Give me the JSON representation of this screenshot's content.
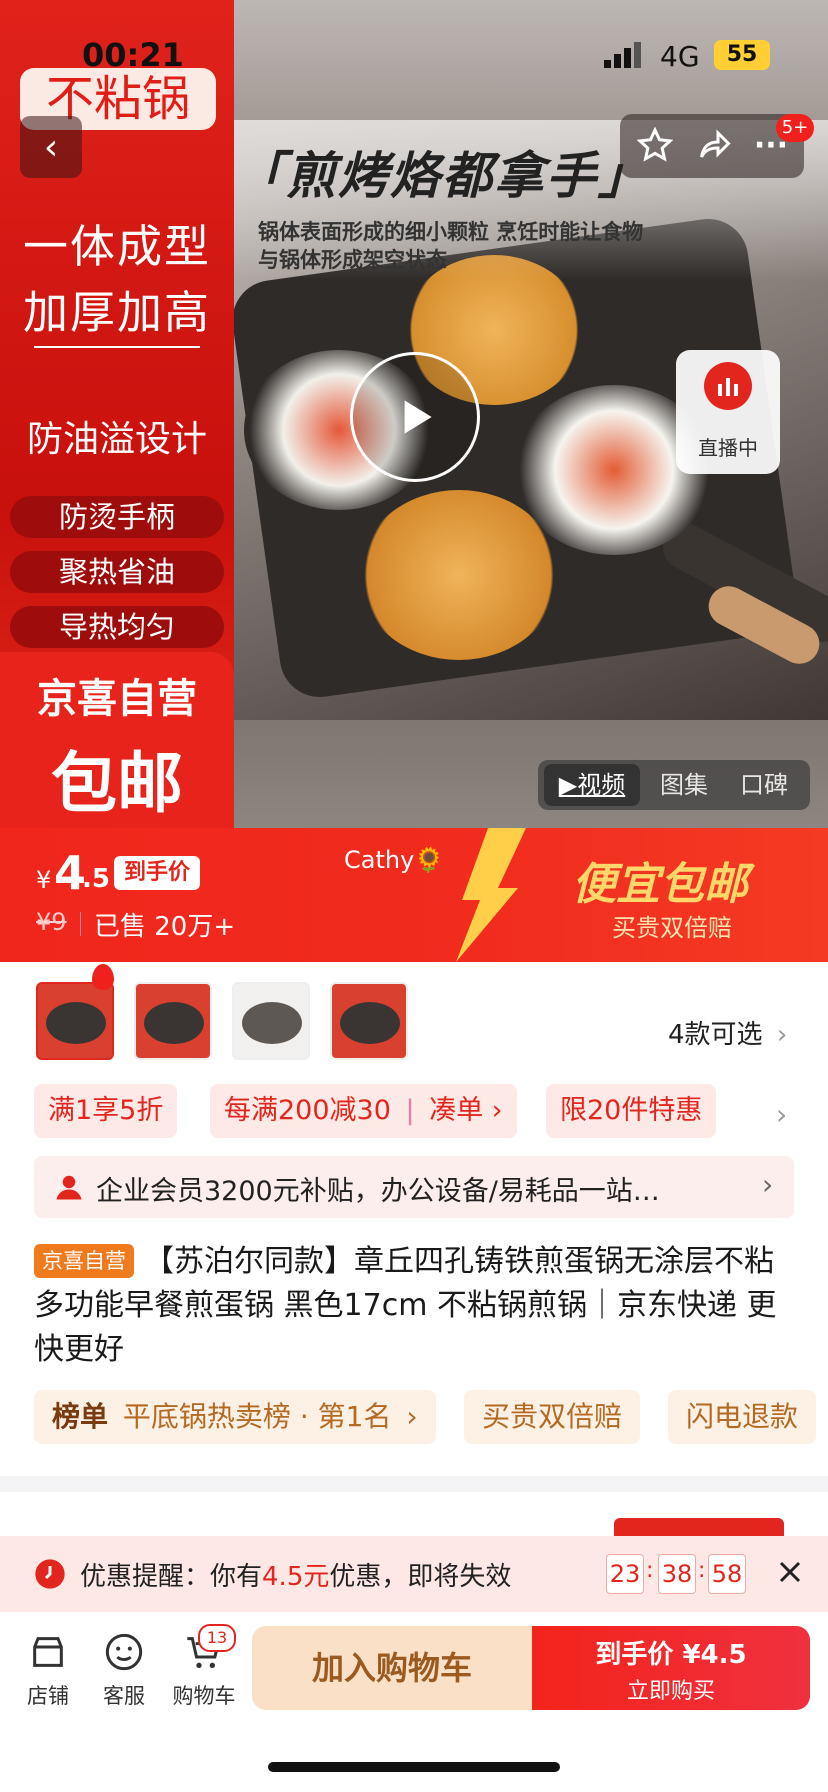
{
  "status_bar": {
    "time": "00:21",
    "network": "4G",
    "battery": "55"
  },
  "hero": {
    "left_banner": {
      "top_label": "不粘锅",
      "line1": "一体成型",
      "line2": "加厚加高",
      "line3": "防油溢设计",
      "pills": [
        "防烫手柄",
        "聚热省油",
        "导热均匀"
      ],
      "self_run": "京喜自营",
      "free_ship": "包邮"
    },
    "photo_title": "「煎烤烙都拿手」",
    "photo_subtitle_1": "锅体表面形成的细小颗粒 烹饪时能让食物",
    "photo_subtitle_2": "与锅体形成架空状态",
    "notification_badge": "5+",
    "live_label": "直播中",
    "media_tabs": [
      "▶视频",
      "图集",
      "口碑"
    ],
    "active_media_tab": "▶视频"
  },
  "price_banner": {
    "currency": "¥",
    "price_int": "4",
    "price_dec": ".5",
    "price_tag": "到手价",
    "original_price": "¥9",
    "sold": "已售 20万+",
    "user": "Cathy🌻",
    "slogan": "便宜包邮",
    "slogan_sub": "买贵双倍赔"
  },
  "variants": {
    "count_label": "4款可选"
  },
  "promos": [
    "满1享5折",
    "每满200减30",
    "凑单 ›",
    "限20件特惠"
  ],
  "enterprise_banner": "企业会员3200元补贴，办公设备/易耗品一站…",
  "product": {
    "badge": "京喜自营",
    "title": "【苏泊尔同款】章丘四孔铸铁煎蛋锅无涂层不粘多功能早餐煎蛋锅 黑色17cm 不粘锅煎锅｜京东快递 更快更好"
  },
  "rank_tags": {
    "rank_label": "榜单",
    "rank_text": "平底锅热卖榜 · 第1名",
    "tag2": "买贵双倍赔",
    "tag3": "闪电退款"
  },
  "coupon_reminder": {
    "prefix": "优惠提醒：你有",
    "amount": "4.5元",
    "suffix": "优惠，即将失效",
    "hh": "23",
    "mm": "38",
    "ss": "58"
  },
  "bottom_nav": {
    "shop": "店铺",
    "service": "客服",
    "cart": "购物车",
    "cart_count": "13",
    "add_cart": "加入购物车",
    "buy_price_label": "到手价 ¥4.5",
    "buy_now": "立即购买"
  },
  "colors": {
    "primary_red": "#e3261d",
    "banner_red": "#f5261b",
    "orange_cta": "#fbe0c8",
    "gold": "#ffd76a"
  }
}
